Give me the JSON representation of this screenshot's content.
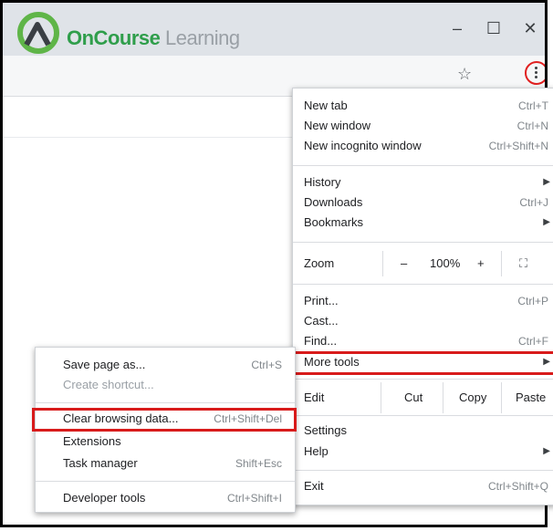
{
  "brand": {
    "name_main": "OnCourse",
    "name_sub": "Learning"
  },
  "window": {
    "minimize": "–",
    "maximize": "☐",
    "close": "✕"
  },
  "toolbar": {
    "bookmark_icon": "☆"
  },
  "menu": {
    "new_tab": {
      "label": "New tab",
      "shortcut": "Ctrl+T"
    },
    "new_window": {
      "label": "New window",
      "shortcut": "Ctrl+N"
    },
    "new_incognito": {
      "label": "New incognito window",
      "shortcut": "Ctrl+Shift+N"
    },
    "history": {
      "label": "History"
    },
    "downloads": {
      "label": "Downloads",
      "shortcut": "Ctrl+J"
    },
    "bookmarks": {
      "label": "Bookmarks"
    },
    "zoom": {
      "label": "Zoom",
      "minus": "–",
      "value": "100%",
      "plus": "+"
    },
    "print": {
      "label": "Print...",
      "shortcut": "Ctrl+P"
    },
    "cast": {
      "label": "Cast..."
    },
    "find": {
      "label": "Find...",
      "shortcut": "Ctrl+F"
    },
    "more_tools": {
      "label": "More tools"
    },
    "edit": {
      "label": "Edit",
      "cut": "Cut",
      "copy": "Copy",
      "paste": "Paste"
    },
    "settings": {
      "label": "Settings"
    },
    "help": {
      "label": "Help"
    },
    "exit": {
      "label": "Exit",
      "shortcut": "Ctrl+Shift+Q"
    }
  },
  "submenu": {
    "save_page": {
      "label": "Save page as...",
      "shortcut": "Ctrl+S"
    },
    "create_shortcut": {
      "label": "Create shortcut..."
    },
    "clear_browsing": {
      "label": "Clear browsing data...",
      "shortcut": "Ctrl+Shift+Del"
    },
    "extensions": {
      "label": "Extensions"
    },
    "task_manager": {
      "label": "Task manager",
      "shortcut": "Shift+Esc"
    },
    "developer_tools": {
      "label": "Developer tools",
      "shortcut": "Ctrl+Shift+I"
    }
  },
  "colors": {
    "highlight": "#d81b1b",
    "brand": "#2f9e4b"
  }
}
